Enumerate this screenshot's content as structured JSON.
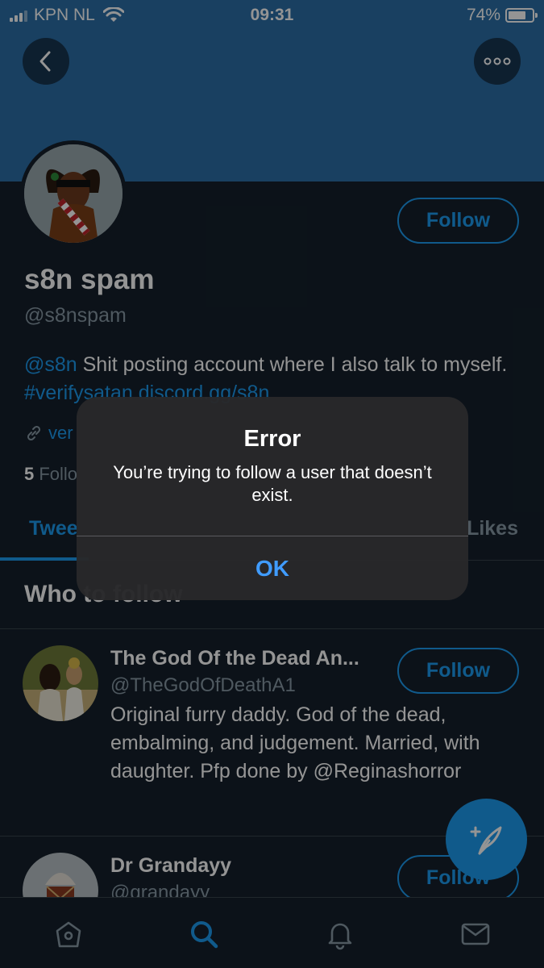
{
  "status_bar": {
    "carrier": "KPN NL",
    "time": "09:31",
    "battery": "74%",
    "battery_level": 0.74
  },
  "profile": {
    "follow_label": "Follow",
    "display_name": "s8n spam",
    "handle": "@s8nspam",
    "bio_mention": "@s8n",
    "bio_text": " Shit posting account where I also talk to myself. ",
    "bio_hashtag": "#verifysatan",
    "bio_link": "discord.gg/s8n",
    "website": "ver",
    "followers_count": "5",
    "followers_label": " Follo"
  },
  "tabs": {
    "tweets": "Twee",
    "likes": "Likes"
  },
  "who_to_follow": {
    "title": "Who to follow",
    "suggestions": [
      {
        "name": "The God Of the Dead An...",
        "handle": "@TheGodOfDeathA1",
        "bio": "Original furry daddy. God of the dead, embalming, and judgement. Married, with daughter. Pfp done by @Reginashorror",
        "follow_label": "Follow"
      },
      {
        "name": "Dr Grandayy",
        "handle": "@grandayy",
        "follow_label": "Follow"
      }
    ]
  },
  "alert": {
    "title": "Error",
    "message": "You’re trying to follow a user that doesn’t exist.",
    "ok_label": "OK"
  },
  "bottom_nav": [
    "home-icon",
    "search-icon",
    "bell-icon",
    "mail-icon"
  ],
  "colors": {
    "accent": "#1d9bf0",
    "background": "#15202b",
    "banner": "#2b6fa8",
    "alert_button": "#409cff"
  }
}
